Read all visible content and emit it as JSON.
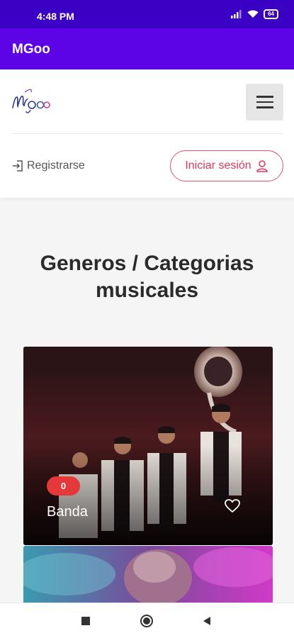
{
  "status_bar": {
    "time": "4:48 PM",
    "battery": "64"
  },
  "app_bar": {
    "title": "MGoo"
  },
  "header": {
    "logo_text": "MGoo",
    "register_label": "Registrarse",
    "login_label": "Iniciar sesión"
  },
  "section": {
    "title": "Generos / Categorias musicales"
  },
  "categories": [
    {
      "name": "Banda",
      "count": "0"
    }
  ],
  "colors": {
    "status_bar": "#3a00c4",
    "app_bar": "#5c04e6",
    "accent": "#e0365c",
    "badge": "#e53939"
  },
  "icons": [
    "signal-icon",
    "wifi-icon",
    "battery-icon",
    "menu-icon",
    "register-icon",
    "user-icon",
    "heart-icon",
    "recents-icon",
    "home-icon",
    "back-icon"
  ]
}
